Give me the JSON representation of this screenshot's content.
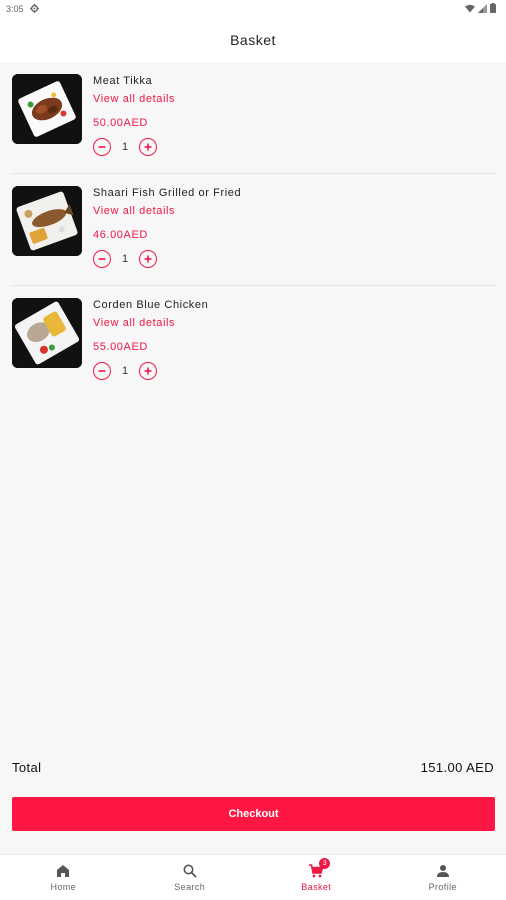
{
  "status_bar": {
    "time": "3:05",
    "settings_icon": "gear-icon",
    "wifi_icon": "wifi-icon",
    "signal_icon": "signal-icon",
    "battery_icon": "battery-icon"
  },
  "header": {
    "title": "Basket"
  },
  "basket": {
    "items": [
      {
        "name": "Meat Tikka",
        "details_link": "View all details",
        "price": "50.00AED",
        "quantity": "1",
        "image_icon": "meat-tikka-image"
      },
      {
        "name": "Shaari Fish Grilled or Fried",
        "details_link": "View all details",
        "price": "46.00AED",
        "quantity": "1",
        "image_icon": "fish-image"
      },
      {
        "name": "Corden Blue Chicken",
        "details_link": "View all details",
        "price": "55.00AED",
        "quantity": "1",
        "image_icon": "chicken-image"
      }
    ]
  },
  "summary": {
    "total_label": "Total",
    "total_value": "151.00 AED",
    "checkout_label": "Checkout"
  },
  "bottom_nav": {
    "items": [
      {
        "label": "Home",
        "icon": "home-icon"
      },
      {
        "label": "Search",
        "icon": "search-icon"
      },
      {
        "label": "Basket",
        "icon": "cart-icon",
        "badge": "3",
        "active": true
      },
      {
        "label": "Profile",
        "icon": "profile-icon"
      }
    ]
  },
  "colors": {
    "accent": "#ee1846",
    "checkout_bg": "#ff1744",
    "background": "#f7f7f7"
  }
}
